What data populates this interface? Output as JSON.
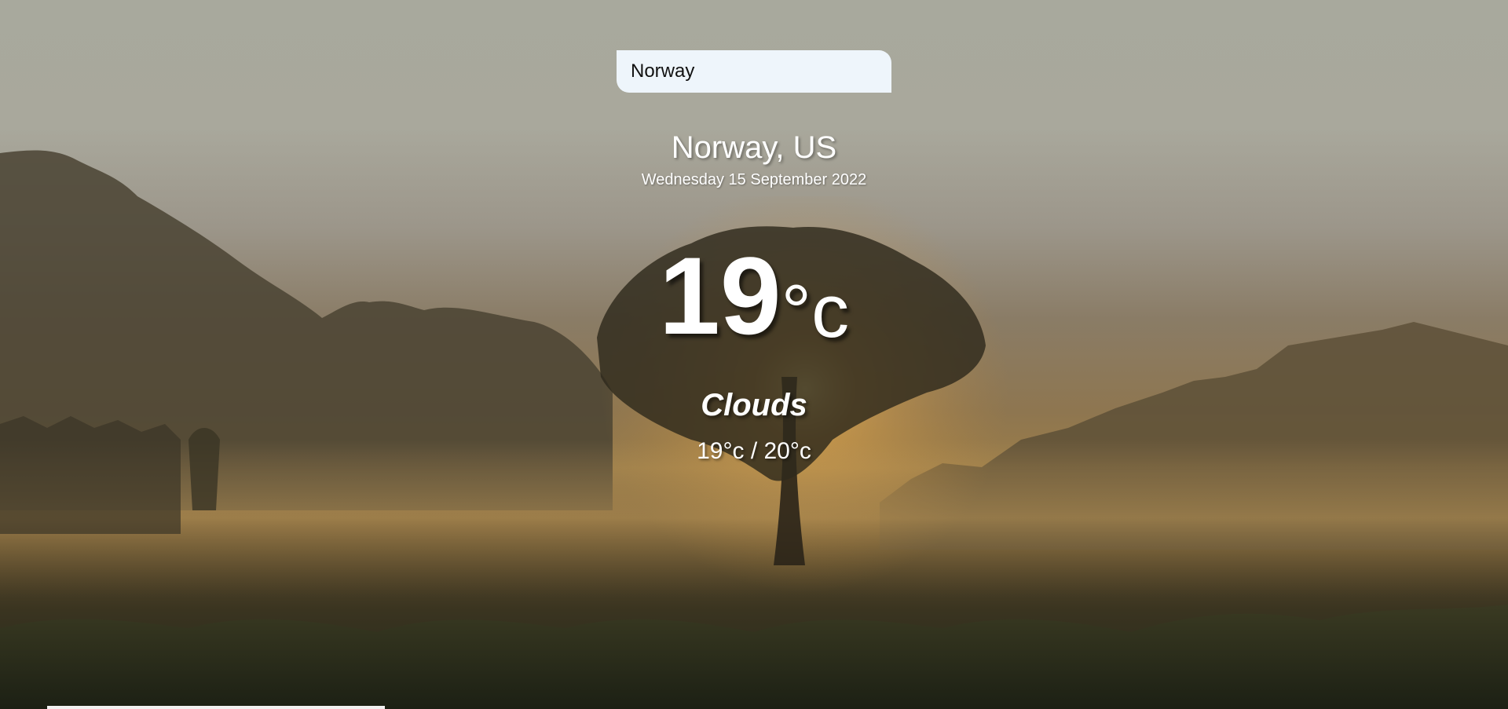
{
  "search": {
    "value": "Norway",
    "placeholder": ""
  },
  "weather": {
    "location": "Norway, US",
    "date": "Wednesday 15 September 2022",
    "temperature": "19",
    "unit": "°c",
    "condition": "Clouds",
    "hi_low": "19°c / 20°c"
  },
  "background": {
    "description_icon": "misty-sunrise-landscape",
    "text_color": "#ffffff",
    "input_background": "#f0f8ff"
  }
}
